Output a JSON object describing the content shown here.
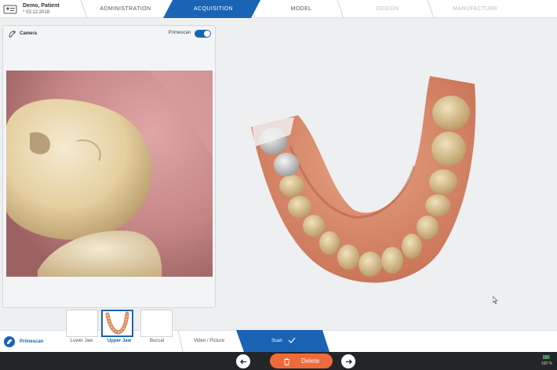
{
  "patient": {
    "name": "Demo, Patient",
    "date": "* 03.12.2018",
    "icon": "patient-id-icon"
  },
  "steps": [
    {
      "label": "ADMINISTRATION",
      "state": "done"
    },
    {
      "label": "ACQUISITION",
      "state": "active"
    },
    {
      "label": "MODEL",
      "state": "done"
    },
    {
      "label": "DESIGN",
      "state": "disabled"
    },
    {
      "label": "MANUFACTURE",
      "state": "disabled"
    }
  ],
  "camera": {
    "title": "Camera",
    "icon": "camera-icon",
    "toggle_label": "Primescan",
    "toggle_on": true
  },
  "scanbar": {
    "brand_label": "Primescan",
    "jaws": [
      {
        "label": "Lower Jaw",
        "active": false
      },
      {
        "label": "Upper Jaw",
        "active": true
      },
      {
        "label": "Buccal",
        "active": false
      }
    ],
    "video_label": "Video / Picture",
    "scan_label": "Scan"
  },
  "toolbar": {
    "back_icon": "arrow-left-icon",
    "forward_icon": "arrow-right-icon",
    "delete_label": "Delete",
    "delete_icon": "trash-icon",
    "zoom": "100 %"
  },
  "colors": {
    "accent": "#1a63b5",
    "delete": "#ef6a3a",
    "toolbar": "#222629",
    "gum": "#d98a6a"
  }
}
